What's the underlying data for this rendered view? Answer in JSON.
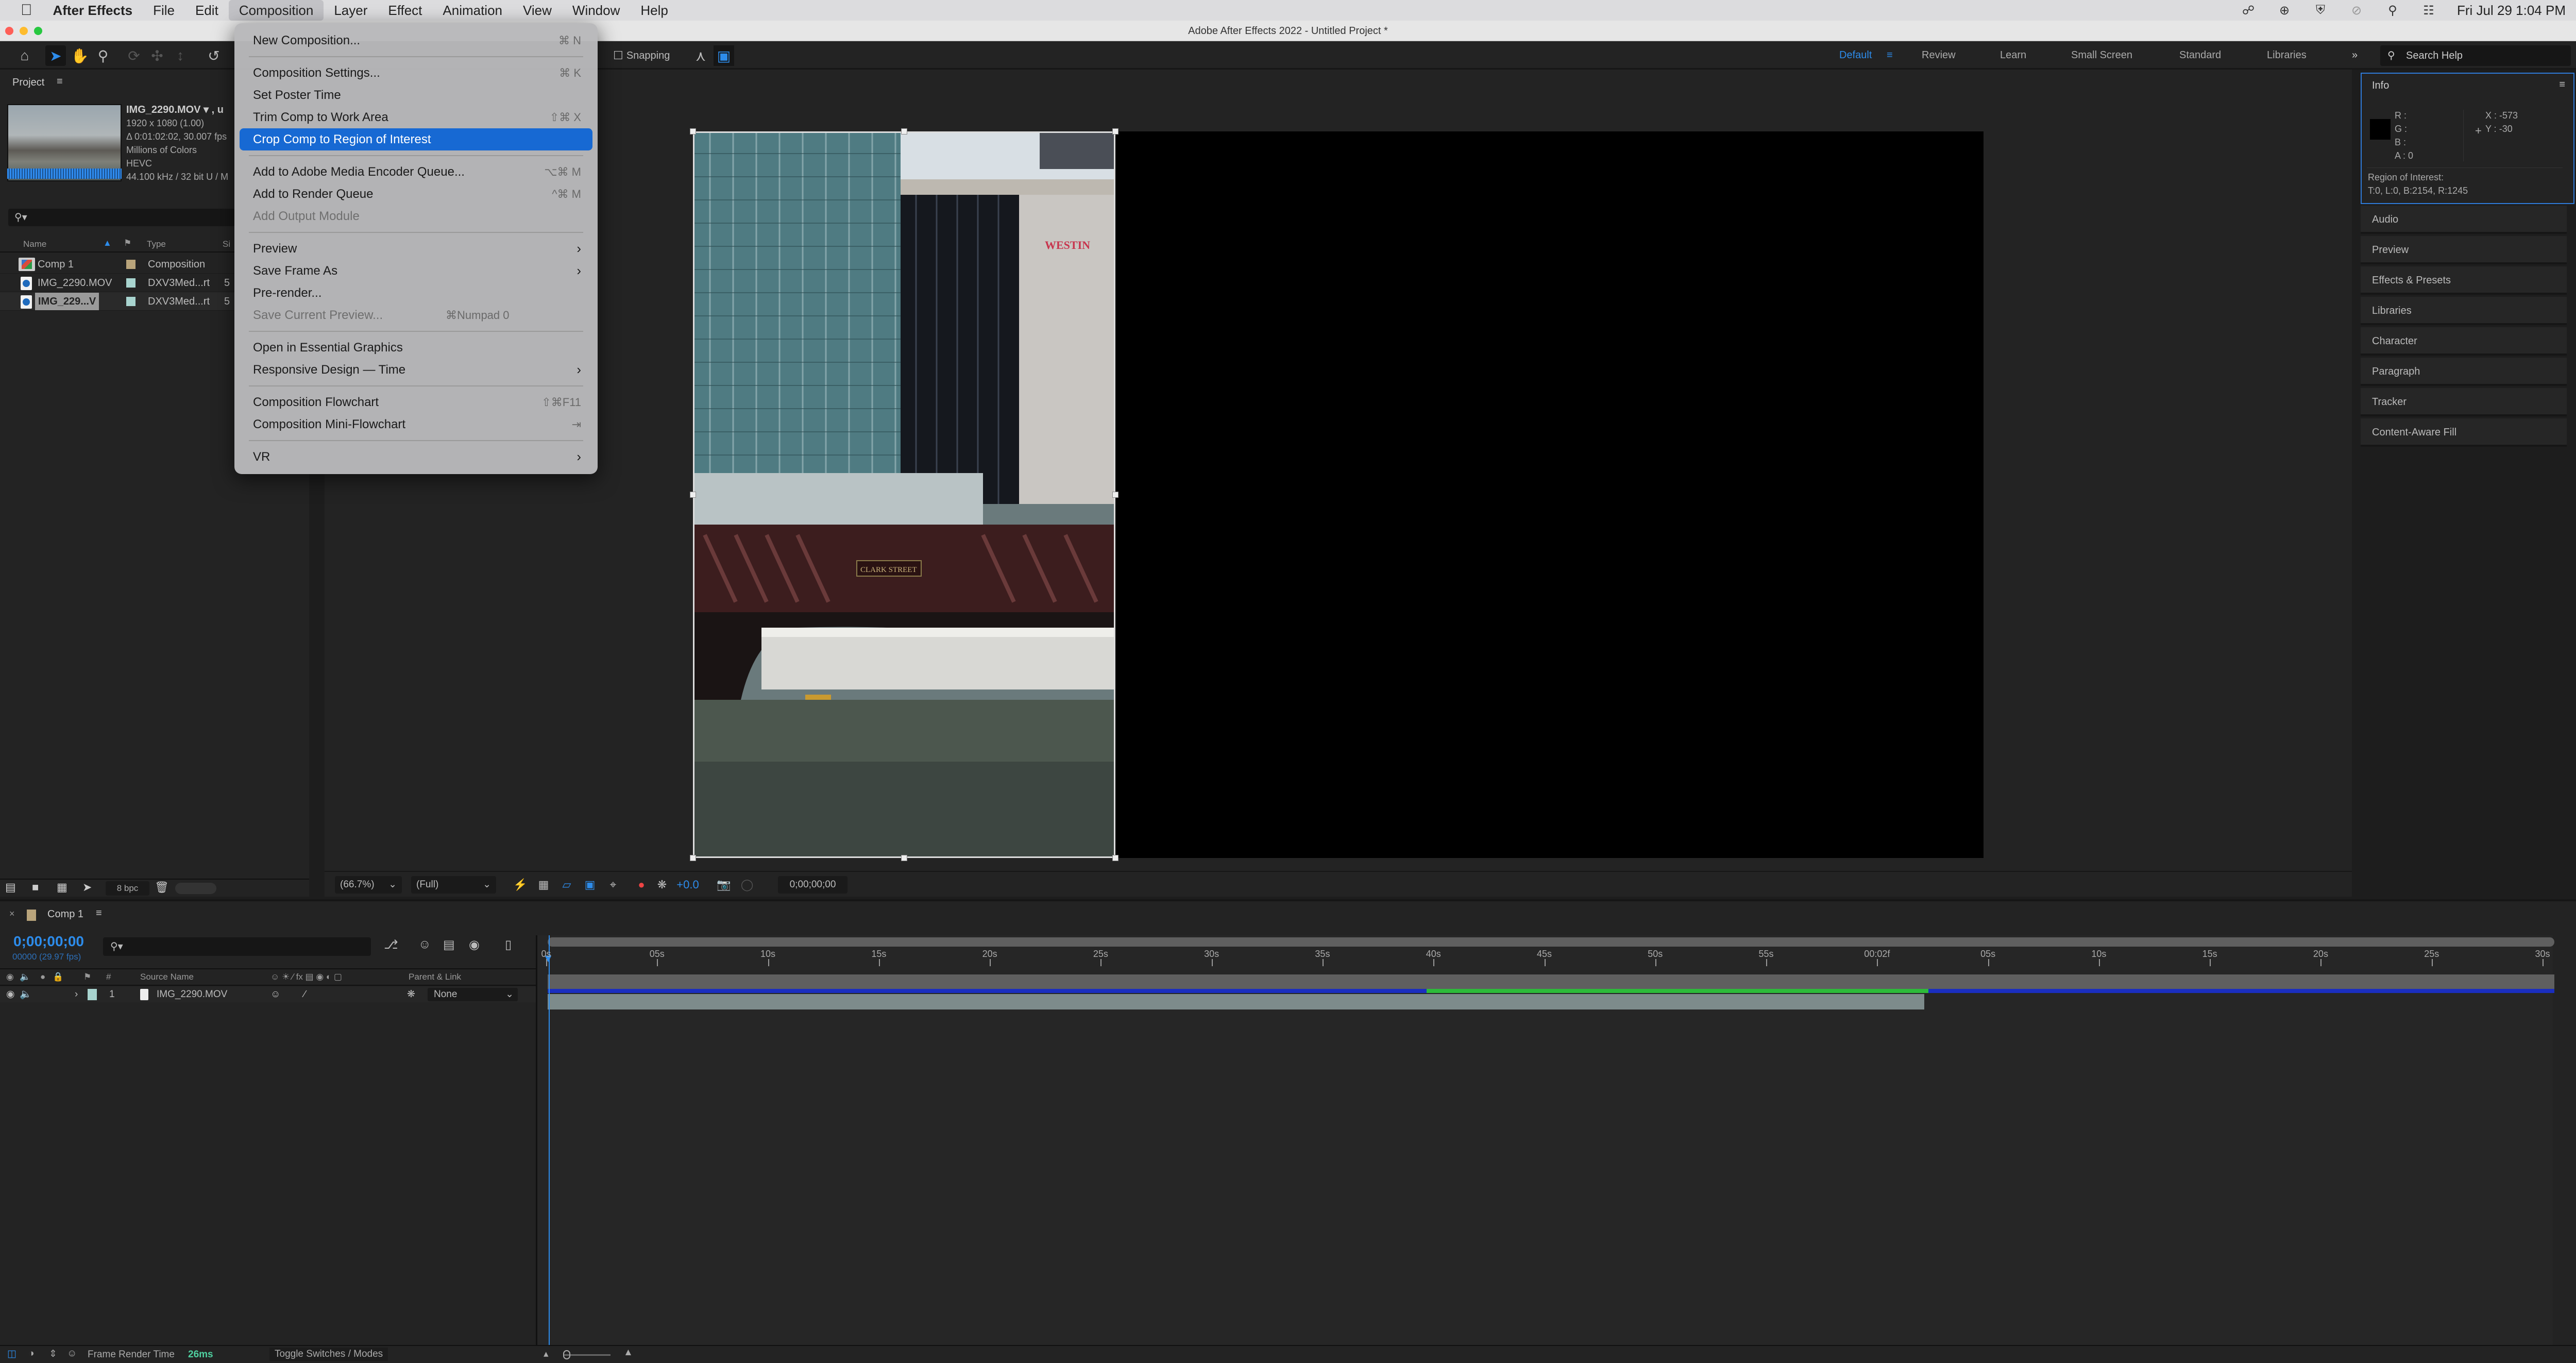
{
  "menubar": {
    "app_name": "After Effects",
    "items": [
      "File",
      "Edit",
      "Composition",
      "Layer",
      "Effect",
      "Animation",
      "View",
      "Window",
      "Help"
    ],
    "active_item": "Composition",
    "clock": "Fri Jul 29  1:04 PM",
    "tray_icons": [
      "creative-cloud-icon",
      "globe-icon",
      "shield-icon",
      "wifi-off-icon",
      "spotlight-search-icon",
      "control-center-icon"
    ]
  },
  "window": {
    "title": "Adobe After Effects 2022 - Untitled Project *"
  },
  "toolbar": {
    "snapping_label": "Snapping",
    "workspaces": [
      "Default",
      "Review",
      "Learn",
      "Small Screen",
      "Standard",
      "Libraries"
    ],
    "active_workspace": "Default",
    "search_placeholder": "Search Help",
    "accent_color": "#2d8ceb"
  },
  "project": {
    "tab_label": "Project",
    "footage": {
      "name": "IMG_2290.MOV ▾ , u",
      "dimensions": "1920 x 1080 (1.00)",
      "duration": "Δ 0:01:02:02, 30.007 fps",
      "colors": "Millions of Colors",
      "codec": "HEVC",
      "audio": "44.100 kHz / 32 bit U / M"
    },
    "search_placeholder": "⌕",
    "columns": {
      "name": "Name",
      "type": "Type",
      "size": "Si"
    },
    "rows": [
      {
        "name": "Comp 1",
        "type": "Composition",
        "size": "",
        "label_color": "#b9a47b",
        "kind": "composition"
      },
      {
        "name": "IMG_2290.MOV",
        "type": "DXV3Med...rt",
        "size": "5",
        "label_color": "#a8d4cf",
        "kind": "footage"
      },
      {
        "name": "IMG_229...V",
        "type": "DXV3Med...rt",
        "size": "5",
        "label_color": "#a8d4cf",
        "kind": "footage",
        "selected": true
      }
    ],
    "bpc": "8 bpc"
  },
  "composition_menu": {
    "items": [
      {
        "label": "New Composition...",
        "shortcut": "⌘ N"
      },
      {
        "separator": true
      },
      {
        "label": "Composition Settings...",
        "shortcut": "⌘ K"
      },
      {
        "label": "Set Poster Time",
        "shortcut": ""
      },
      {
        "label": "Trim Comp to Work Area",
        "shortcut": "⇧⌘ X"
      },
      {
        "label": "Crop Comp to Region of Interest",
        "shortcut": "",
        "highlighted": true
      },
      {
        "separator": true
      },
      {
        "label": "Add to Adobe Media Encoder Queue...",
        "shortcut": "⌥⌘ M"
      },
      {
        "label": "Add to Render Queue",
        "shortcut": "^⌘ M"
      },
      {
        "label": "Add Output Module",
        "shortcut": "",
        "disabled": true
      },
      {
        "separator": true
      },
      {
        "label": "Preview",
        "submenu": true
      },
      {
        "label": "Save Frame As",
        "submenu": true
      },
      {
        "label": "Pre-render...",
        "shortcut": ""
      },
      {
        "label": "Save Current Preview...",
        "shortcut": "⌘Numpad 0",
        "disabled": true
      },
      {
        "separator": true
      },
      {
        "label": "Open in Essential Graphics",
        "shortcut": ""
      },
      {
        "label": "Responsive Design — Time",
        "submenu": true
      },
      {
        "separator": true
      },
      {
        "label": "Composition Flowchart",
        "shortcut": "⇧⌘F11"
      },
      {
        "label": "Composition Mini-Flowchart",
        "shortcut": "⇥"
      },
      {
        "separator": true
      },
      {
        "label": "VR",
        "submenu": true
      }
    ]
  },
  "viewer": {
    "zoom": "(66.7%)",
    "resolution": "(Full)",
    "exposure": "+0.0",
    "timecode": "0;00;00;00",
    "video_text": {
      "sign": "WESTIN",
      "bridge": "CLARK STREET"
    }
  },
  "info": {
    "title": "Info",
    "r_label": "R :",
    "g_label": "G :",
    "b_label": "B :",
    "a_label": "A :",
    "a_value": "0",
    "x_label": "X :",
    "x_value": "-573",
    "y_label": "Y :",
    "y_value": "-30",
    "roi_label": "Region of Interest:",
    "roi_value": "T:0, L:0, B:2154, R:1245"
  },
  "right_panels": [
    "Audio",
    "Preview",
    "Effects & Presets",
    "Libraries",
    "Character",
    "Paragraph",
    "Tracker",
    "Content-Aware Fill"
  ],
  "timeline": {
    "tab_label": "Comp 1",
    "timecode": "0;00;00;00",
    "frame_info": "00000 (29.97 fps)",
    "columns": {
      "source_name": "Source Name",
      "number": "#",
      "parent_link": "Parent & Link"
    },
    "layers": [
      {
        "index": "1",
        "name": "IMG_2290.MOV",
        "parent": "None",
        "label_color": "#a8d4cf",
        "duration_fraction": 0.686
      }
    ],
    "ruler_labels": [
      "0s",
      "05s",
      "10s",
      "15s",
      "20s",
      "25s",
      "30s",
      "35s",
      "40s",
      "45s",
      "50s",
      "55s",
      "00:02f",
      "05s",
      "10s",
      "15s",
      "20s",
      "25s",
      "30s"
    ],
    "render_cached_fraction": {
      "start": 0.438,
      "end": 0.688
    }
  },
  "statusbar": {
    "frame_render_label": "Frame Render Time",
    "frame_render_value": "26ms",
    "toggle_label": "Toggle Switches / Modes"
  }
}
